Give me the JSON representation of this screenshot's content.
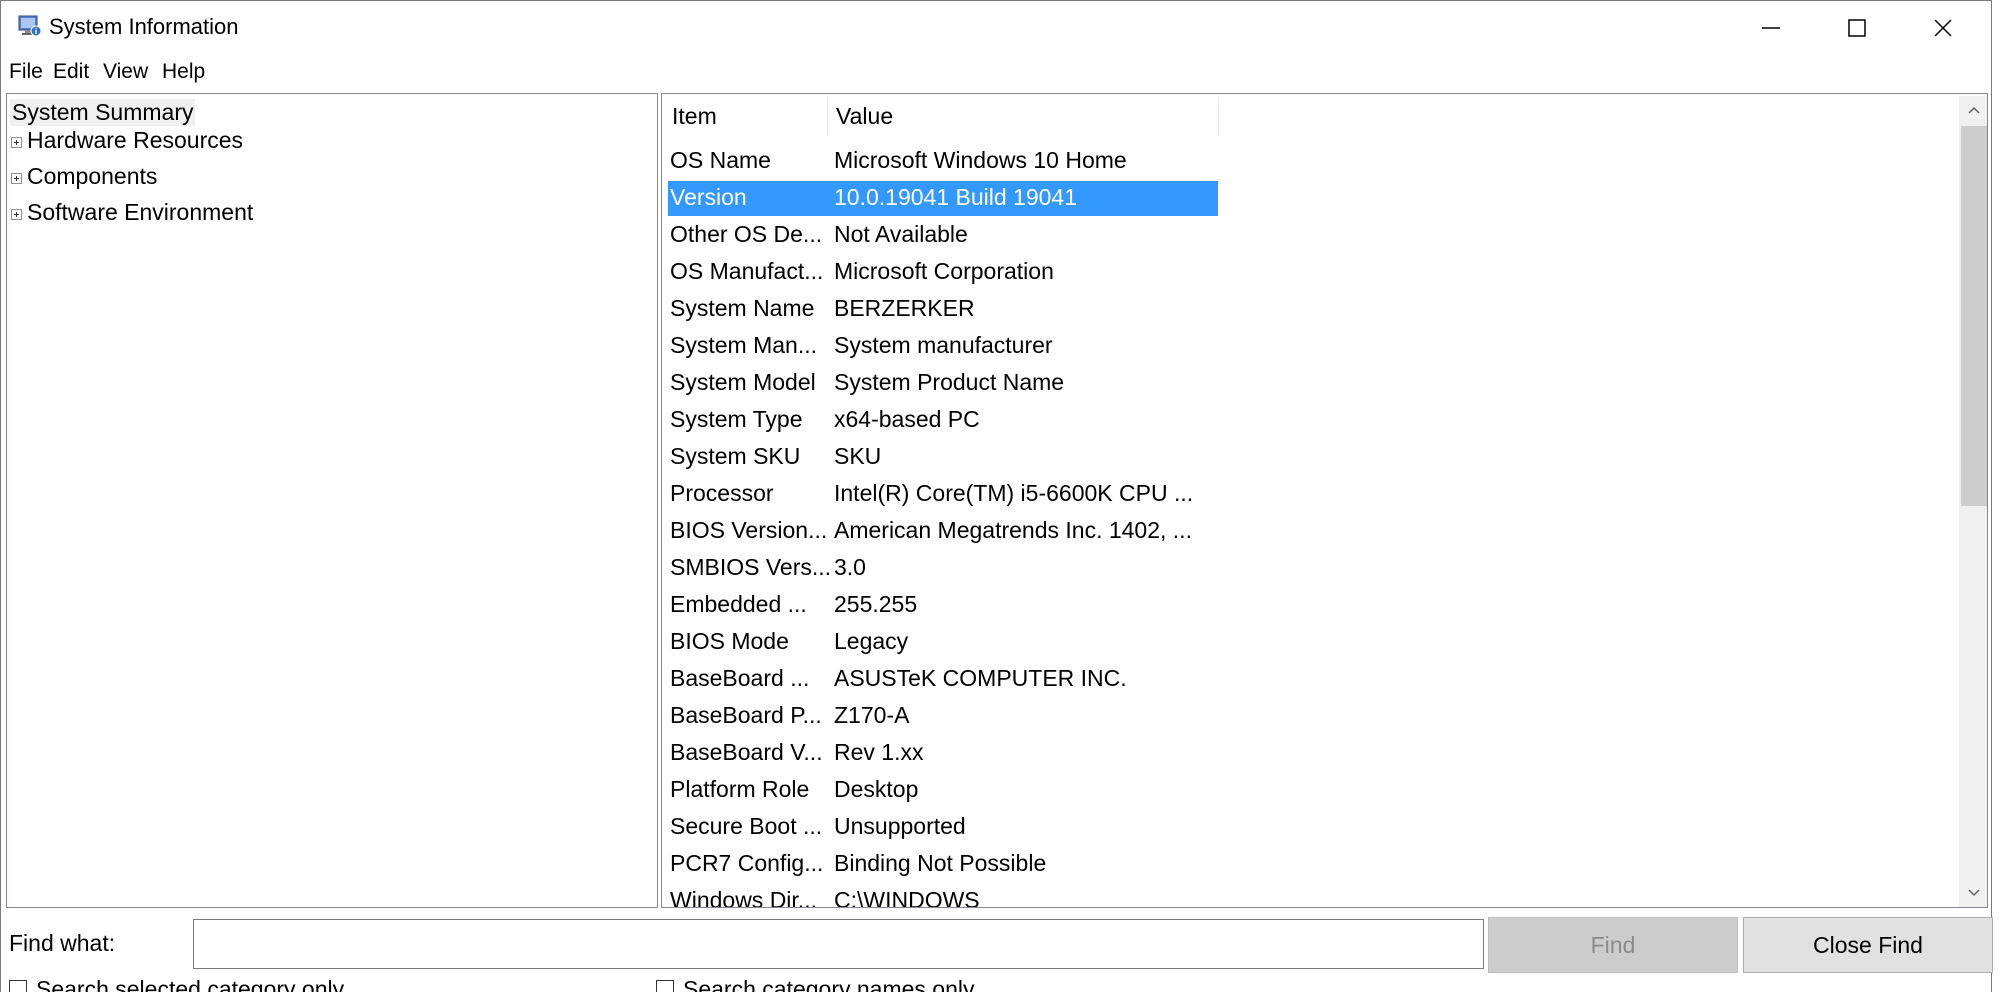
{
  "window": {
    "title": "System Information",
    "icon": "system-information-icon",
    "controls": {
      "minimize": "minimize-icon",
      "maximize": "maximize-icon",
      "close": "close-icon"
    }
  },
  "menu": [
    "File",
    "Edit",
    "View",
    "Help"
  ],
  "tree": [
    {
      "label": "System Summary",
      "selected": true,
      "expandable": false
    },
    {
      "label": "Hardware Resources",
      "selected": false,
      "expandable": true
    },
    {
      "label": "Components",
      "selected": false,
      "expandable": true
    },
    {
      "label": "Software Environment",
      "selected": false,
      "expandable": true
    }
  ],
  "list": {
    "columns": [
      "Item",
      "Value"
    ],
    "selected_index": 1,
    "selection_color": "#3399ff",
    "rows": [
      {
        "item": "OS Name",
        "value": "Microsoft Windows 10 Home"
      },
      {
        "item": "Version",
        "value": "10.0.19041 Build 19041"
      },
      {
        "item": "Other OS De...",
        "value": "Not Available"
      },
      {
        "item": "OS Manufact...",
        "value": "Microsoft Corporation"
      },
      {
        "item": "System Name",
        "value": "BERZERKER"
      },
      {
        "item": "System Man...",
        "value": "System manufacturer"
      },
      {
        "item": "System Model",
        "value": "System Product Name"
      },
      {
        "item": "System Type",
        "value": "x64-based PC"
      },
      {
        "item": "System SKU",
        "value": "SKU"
      },
      {
        "item": "Processor",
        "value": "Intel(R) Core(TM) i5-6600K CPU ..."
      },
      {
        "item": "BIOS Version...",
        "value": "American Megatrends Inc. 1402, ..."
      },
      {
        "item": "SMBIOS Vers...",
        "value": "3.0"
      },
      {
        "item": "Embedded ...",
        "value": "255.255"
      },
      {
        "item": "BIOS Mode",
        "value": "Legacy"
      },
      {
        "item": "BaseBoard ...",
        "value": "ASUSTeK COMPUTER INC."
      },
      {
        "item": "BaseBoard P...",
        "value": "Z170-A"
      },
      {
        "item": "BaseBoard V...",
        "value": "Rev 1.xx"
      },
      {
        "item": "Platform Role",
        "value": "Desktop"
      },
      {
        "item": "Secure Boot ...",
        "value": "Unsupported"
      },
      {
        "item": "PCR7 Config...",
        "value": "Binding Not Possible"
      },
      {
        "item": "Windows Dir...",
        "value": "C:\\WINDOWS"
      }
    ]
  },
  "find": {
    "label": "Find what:",
    "value": "",
    "find_button": "Find",
    "close_button": "Close Find",
    "search_selected_label": "Search selected category only",
    "search_names_label": "Search category names only"
  }
}
